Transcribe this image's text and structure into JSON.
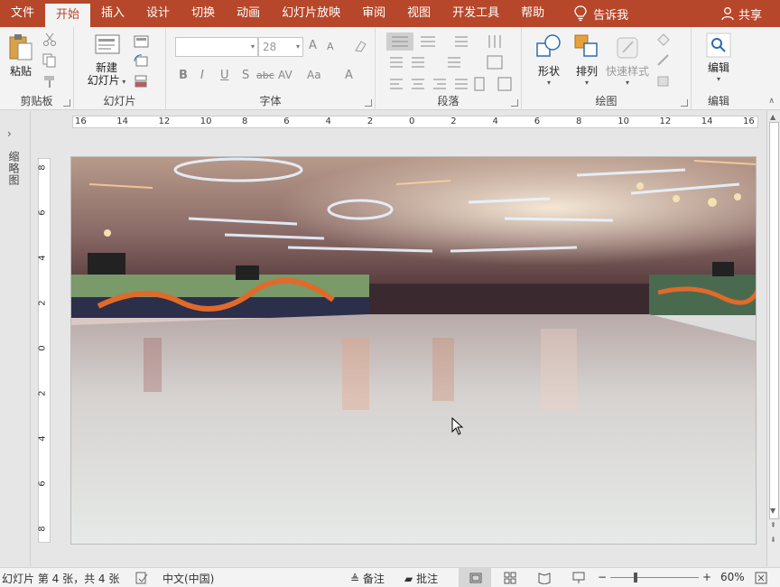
{
  "tabs": [
    {
      "label": "文件",
      "active": false
    },
    {
      "label": "开始",
      "active": true
    },
    {
      "label": "插入",
      "active": false
    },
    {
      "label": "设计",
      "active": false
    },
    {
      "label": "切换",
      "active": false
    },
    {
      "label": "动画",
      "active": false
    },
    {
      "label": "幻灯片放映",
      "active": false
    },
    {
      "label": "审阅",
      "active": false
    },
    {
      "label": "视图",
      "active": false
    },
    {
      "label": "开发工具",
      "active": false
    },
    {
      "label": "帮助",
      "active": false
    }
  ],
  "tellme": {
    "label": "告诉我",
    "icon": "lightbulb-icon"
  },
  "share": {
    "label": "共享",
    "icon": "person-icon"
  },
  "ribbon": {
    "clipboard": {
      "label": "剪贴板",
      "paste": "粘贴"
    },
    "slides": {
      "label": "幻灯片",
      "new_slide_line1": "新建",
      "new_slide_line2": "幻灯片"
    },
    "font": {
      "label": "字体",
      "font_name": "",
      "font_size": "28",
      "bold": "B",
      "italic": "I",
      "underline": "U",
      "shadow": "S",
      "strike": "abc",
      "spacing": "AV",
      "case": "Aa",
      "color": "A",
      "grow": "A",
      "shrink": "A"
    },
    "paragraph": {
      "label": "段落"
    },
    "drawing": {
      "label": "绘图",
      "shapes": "形状",
      "arrange": "排列",
      "quick_styles": "快速样式"
    },
    "editing": {
      "label": "编辑",
      "edit": "编辑"
    }
  },
  "leftpane": {
    "title": "缩略图"
  },
  "ruler": {
    "horizontal": [
      "16",
      "14",
      "12",
      "10",
      "8",
      "6",
      "4",
      "2",
      "0",
      "2",
      "4",
      "6",
      "8",
      "10",
      "12",
      "14",
      "16"
    ],
    "vertical": [
      "8",
      "6",
      "4",
      "2",
      "0",
      "2",
      "4",
      "6",
      "8"
    ]
  },
  "status": {
    "slide_info": "幻灯片 第 4 张，共 4 张",
    "language": "中文(中国)",
    "notes": "备注",
    "comments": "批注",
    "zoom": "60%"
  },
  "colors": {
    "accent": "#b7472a",
    "ribbon_bg": "#f3f3f3"
  }
}
